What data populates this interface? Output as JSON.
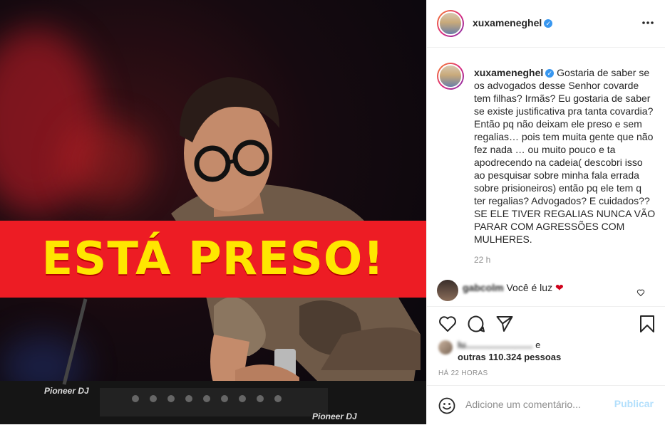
{
  "post": {
    "banner_text": "ESTÁ PRESO!",
    "deck_label_1": "Pioneer DJ",
    "deck_label_2": "Pioneer DJ"
  },
  "header": {
    "username": "xuxameneghel",
    "more_icon": "more-horizontal-icon"
  },
  "caption": {
    "username": "xuxameneghel",
    "text": "Gostaria de saber se os advogados desse Senhor covarde tem filhas? Irmãs? Eu gostaria de saber se existe justificativa pra tanta covardia? Então pq não deixam ele preso e sem regalias… pois tem muita gente que não fez nada … ou muito pouco e ta apodrecendo na cadeia( descobri isso ao pesquisar sobre minha fala errada sobre prisioneiros) então pq ele tem q ter regalias? Advogados? E cuidados?? SE ELE TIVER REGALIAS NUNCA VÃO PARAR COM AGRESSÕES COM MULHERES.",
    "time": "22 h"
  },
  "comment": {
    "username": "gabcolm",
    "text": "Você é luz"
  },
  "likes": {
    "liked_by_blurred": "lu..........................",
    "conj": "e",
    "others": "outras 110.324 pessoas"
  },
  "time_ago": "HÁ 22 HORAS",
  "add_comment": {
    "placeholder": "Adicione um comentário...",
    "publish_label": "Publicar"
  },
  "colors": {
    "banner_red": "#ed1c24",
    "banner_yellow": "#ffe600",
    "verified_blue": "#3897f0",
    "publish_disabled": "#b2dffc",
    "heart_red": "#ed4956"
  }
}
